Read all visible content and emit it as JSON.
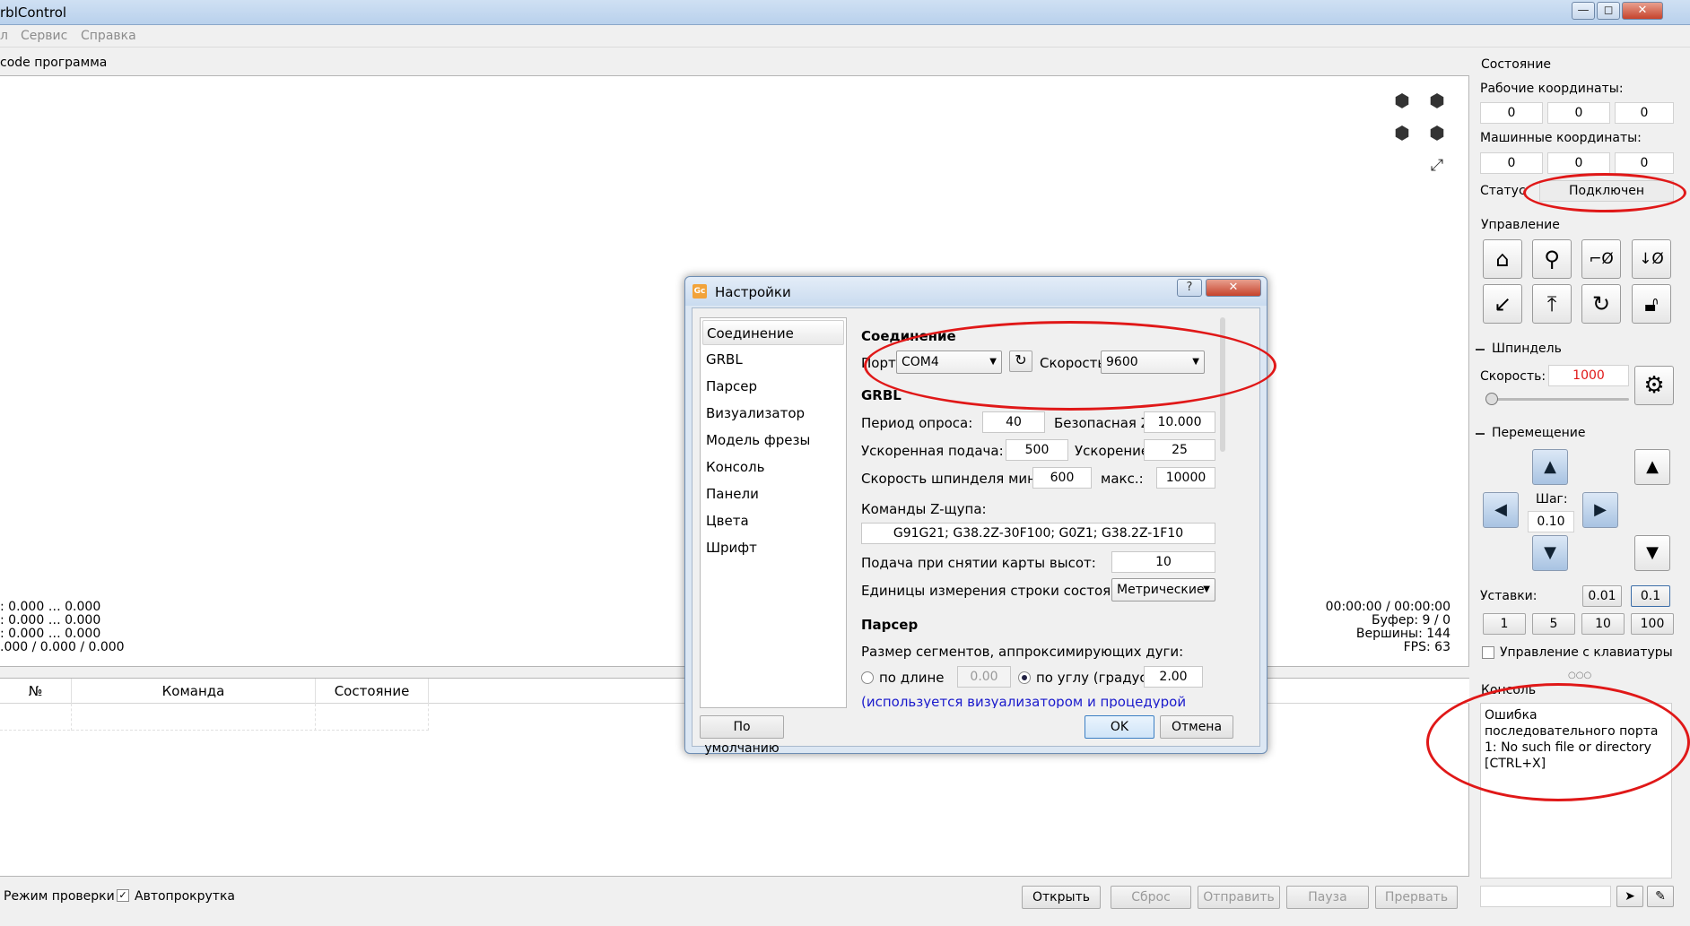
{
  "window": {
    "title": "rblControl",
    "controls": {
      "minimize": "—",
      "maximize": "◻",
      "close": "✕"
    }
  },
  "menu": [
    "л",
    "Сервис",
    "Справка"
  ],
  "main": {
    "gcode_label": "code программа",
    "coords_text": ": 0.000 … 0.000\n: 0.000 … 0.000\n: 0.000 … 0.000\n.000 / 0.000 / 0.000",
    "stats": {
      "time": "00:00:00 / 00:00:00",
      "buffer": "Буфер: 9 / 0",
      "vertices": "Вершины: 144",
      "fps": "FPS: 63"
    },
    "table": {
      "headers": [
        "№",
        "Команда",
        "Состояние"
      ]
    },
    "check_mode": "Режим проверки",
    "autoscroll": "Автопрокрутка",
    "buttons": {
      "open": "Открыть",
      "reset": "Сброс",
      "send": "Отправить",
      "pause": "Пауза",
      "abort": "Прервать"
    }
  },
  "state": {
    "title": "Состояние",
    "work_coords_label": "Рабочие координаты:",
    "work_coords": [
      "0",
      "0",
      "0"
    ],
    "machine_coords_label": "Машинные координаты:",
    "machine_coords": [
      "0",
      "0",
      "0"
    ],
    "status_label": "Статус",
    "status_value": "Подключен"
  },
  "control": {
    "title": "Управление"
  },
  "spindle": {
    "title": "Шпиндель",
    "speed_label": "Скорость:",
    "speed_value": "1000",
    "slider_fraction": 0.0
  },
  "jog": {
    "title": "Перемещение",
    "step_label": "Шаг:",
    "step_value": "0.10",
    "presets_label": "Уставки:",
    "presets": [
      "0.01",
      "0.1",
      "1",
      "5",
      "10",
      "100"
    ],
    "keyboard_label": "Управление с клавиатуры"
  },
  "console": {
    "title": "Консоль",
    "text": "Ошибка последовательного порта 1: No such file or directory\n[CTRL+X]"
  },
  "dialog": {
    "title": "Настройки",
    "help": "?",
    "close": "✕",
    "nav": [
      "Соединение",
      "GRBL",
      "Парсер",
      "Визуализатор",
      "Модель фрезы",
      "Консоль",
      "Панели",
      "Цвета",
      "Шрифт"
    ],
    "connection_title": "Соединение",
    "port_label": "Порт:",
    "port_value": "COM4",
    "speed_label": "Скорость:",
    "speed_value": "9600",
    "grbl_title": "GRBL",
    "poll_label": "Период опроса:",
    "poll_value": "40",
    "safe_z_label": "Безопасная Z:",
    "safe_z_value": "10.000",
    "rapid_label": "Ускоренная подача:",
    "rapid_value": "500",
    "accel_label": "Ускорение:",
    "accel_value": "25",
    "spindle_min_label": "Скорость шпинделя мин.:",
    "spindle_min_value": "600",
    "spindle_max_label": "макс.:",
    "spindle_max_value": "10000",
    "probe_label": "Команды Z-щупа:",
    "probe_value": "G91G21; G38.2Z-30F100; G0Z1; G38.2Z-1F10",
    "heightmap_feed_label": "Подача при снятии карты высот:",
    "heightmap_feed_value": "10",
    "units_label": "Единицы измерения строки состояния:",
    "units_value": "Метрические",
    "parser_title": "Парсер",
    "segments_label": "Размер сегментов, аппроксимирующих дуги:",
    "by_length_label": "по длине",
    "by_length_value": "0.00",
    "by_angle_label": "по углу (градус)",
    "by_angle_value": "2.00",
    "note": "(используется визуализатором и процедурой",
    "defaults": "По умолчанию",
    "ok": "OK",
    "cancel": "Отмена"
  },
  "colors": {
    "annotation": "#e01818",
    "spindle_value": "#e01818",
    "link": "#1a1acc"
  }
}
